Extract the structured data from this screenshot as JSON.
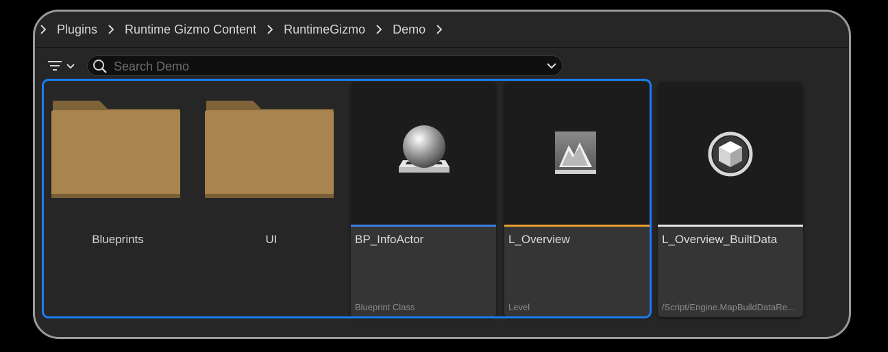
{
  "breadcrumb": {
    "items": [
      "Plugins",
      "Runtime Gizmo Content",
      "RuntimeGizmo",
      "Demo"
    ]
  },
  "search": {
    "placeholder": "Search Demo"
  },
  "folders": [
    {
      "label": "Blueprints"
    },
    {
      "label": "UI"
    }
  ],
  "assets": [
    {
      "name": "BP_InfoActor",
      "type": "Blueprint Class",
      "accent": "#3f7fe0"
    },
    {
      "name": "L_Overview",
      "type": "Level",
      "accent": "#e8a030"
    },
    {
      "name": "L_Overview_BuiltData",
      "type": "/Script/Engine.MapBuildDataRe...",
      "accent": "#e6e6e6"
    }
  ],
  "colors": {
    "selection": "#1b7cf2",
    "folder": "#a9844f"
  }
}
